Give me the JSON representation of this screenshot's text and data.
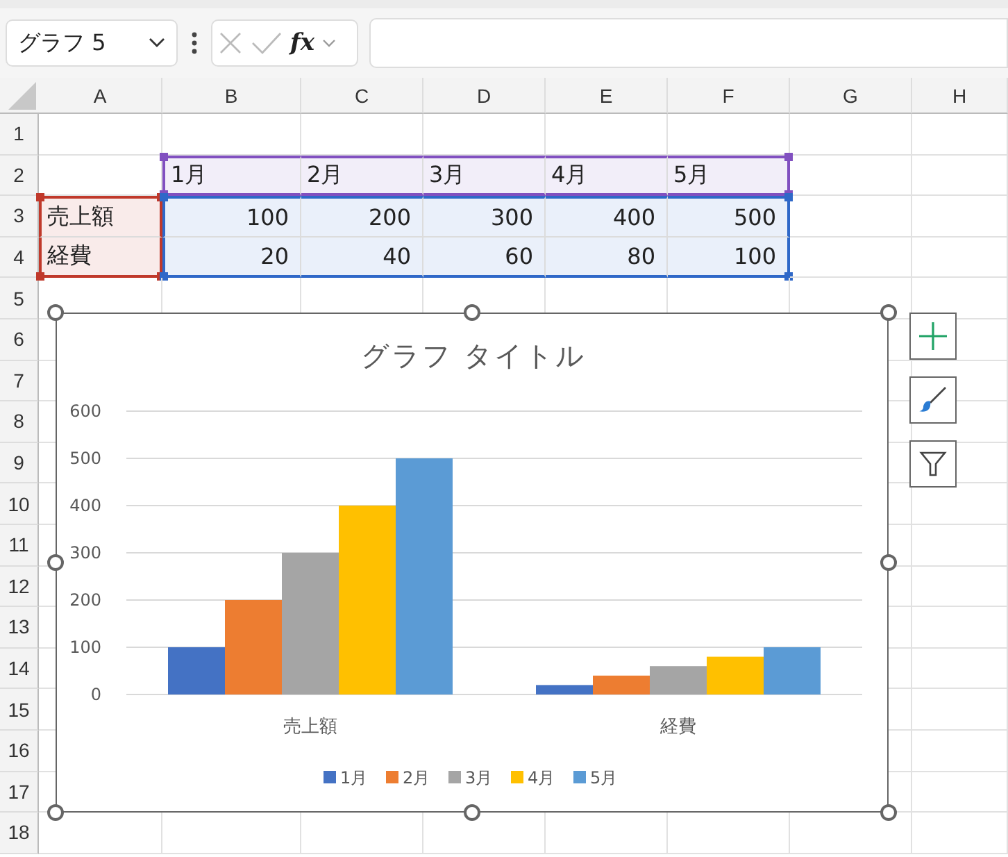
{
  "name_box": {
    "value": "グラフ 5"
  },
  "formula_bar": {
    "function_label": "fx"
  },
  "sheet": {
    "columns": [
      "A",
      "B",
      "C",
      "D",
      "E",
      "F",
      "G",
      "H"
    ],
    "rows": [
      {
        "label": "1",
        "cells": []
      },
      {
        "label": "2",
        "cells": [
          {},
          {
            "value": "1月",
            "kind": "text",
            "color": "#8150c0"
          },
          {
            "value": "2月",
            "kind": "text",
            "color": "#8150c0"
          },
          {
            "value": "3月",
            "kind": "text",
            "color": "#8150c0"
          },
          {
            "value": "4月",
            "kind": "text",
            "color": "#8150c0"
          },
          {
            "value": "5月",
            "kind": "text",
            "color": "#8150c0"
          }
        ]
      },
      {
        "label": "3",
        "cells": [
          {
            "value": "売上額",
            "kind": "text",
            "color": "#c0392b"
          },
          {
            "value": "100",
            "kind": "number",
            "color": "#2f68c8"
          },
          {
            "value": "200",
            "kind": "number",
            "color": "#2f68c8"
          },
          {
            "value": "300",
            "kind": "number",
            "color": "#2f68c8"
          },
          {
            "value": "400",
            "kind": "number",
            "color": "#2f68c8"
          },
          {
            "value": "500",
            "kind": "number",
            "color": "#2f68c8"
          }
        ]
      },
      {
        "label": "4",
        "cells": [
          {
            "value": "経費",
            "kind": "text",
            "color": "#c0392b"
          },
          {
            "value": "20",
            "kind": "number",
            "color": "#2f68c8"
          },
          {
            "value": "40",
            "kind": "number",
            "color": "#2f68c8"
          },
          {
            "value": "60",
            "kind": "number",
            "color": "#2f68c8"
          },
          {
            "value": "80",
            "kind": "number",
            "color": "#2f68c8"
          },
          {
            "value": "100",
            "kind": "number",
            "color": "#2f68c8"
          }
        ]
      },
      {
        "label": "5",
        "cells": []
      },
      {
        "label": "6",
        "cells": []
      },
      {
        "label": "7",
        "cells": []
      },
      {
        "label": "8",
        "cells": []
      },
      {
        "label": "9",
        "cells": []
      },
      {
        "label": "10",
        "cells": []
      },
      {
        "label": "11",
        "cells": []
      },
      {
        "label": "12",
        "cells": []
      },
      {
        "label": "13",
        "cells": []
      },
      {
        "label": "14",
        "cells": []
      },
      {
        "label": "15",
        "cells": []
      },
      {
        "label": "16",
        "cells": []
      },
      {
        "label": "17",
        "cells": []
      },
      {
        "label": "18",
        "cells": []
      }
    ]
  },
  "chart": {
    "chart_data": {
      "type": "bar",
      "title": "グラフ タイトル",
      "categories": [
        "売上額",
        "経費"
      ],
      "series": [
        {
          "name": "1月",
          "color": "#4472c4",
          "values": [
            100,
            20
          ]
        },
        {
          "name": "2月",
          "color": "#ed7d31",
          "values": [
            200,
            40
          ]
        },
        {
          "name": "3月",
          "color": "#a5a5a5",
          "values": [
            300,
            60
          ]
        },
        {
          "name": "4月",
          "color": "#ffc000",
          "values": [
            400,
            80
          ]
        },
        {
          "name": "5月",
          "color": "#5b9bd5",
          "values": [
            500,
            100
          ]
        }
      ],
      "ylim": [
        0,
        600
      ],
      "yticks": [
        0,
        100,
        200,
        300,
        400,
        500,
        600
      ],
      "grid": true,
      "legend": "bottom"
    }
  }
}
